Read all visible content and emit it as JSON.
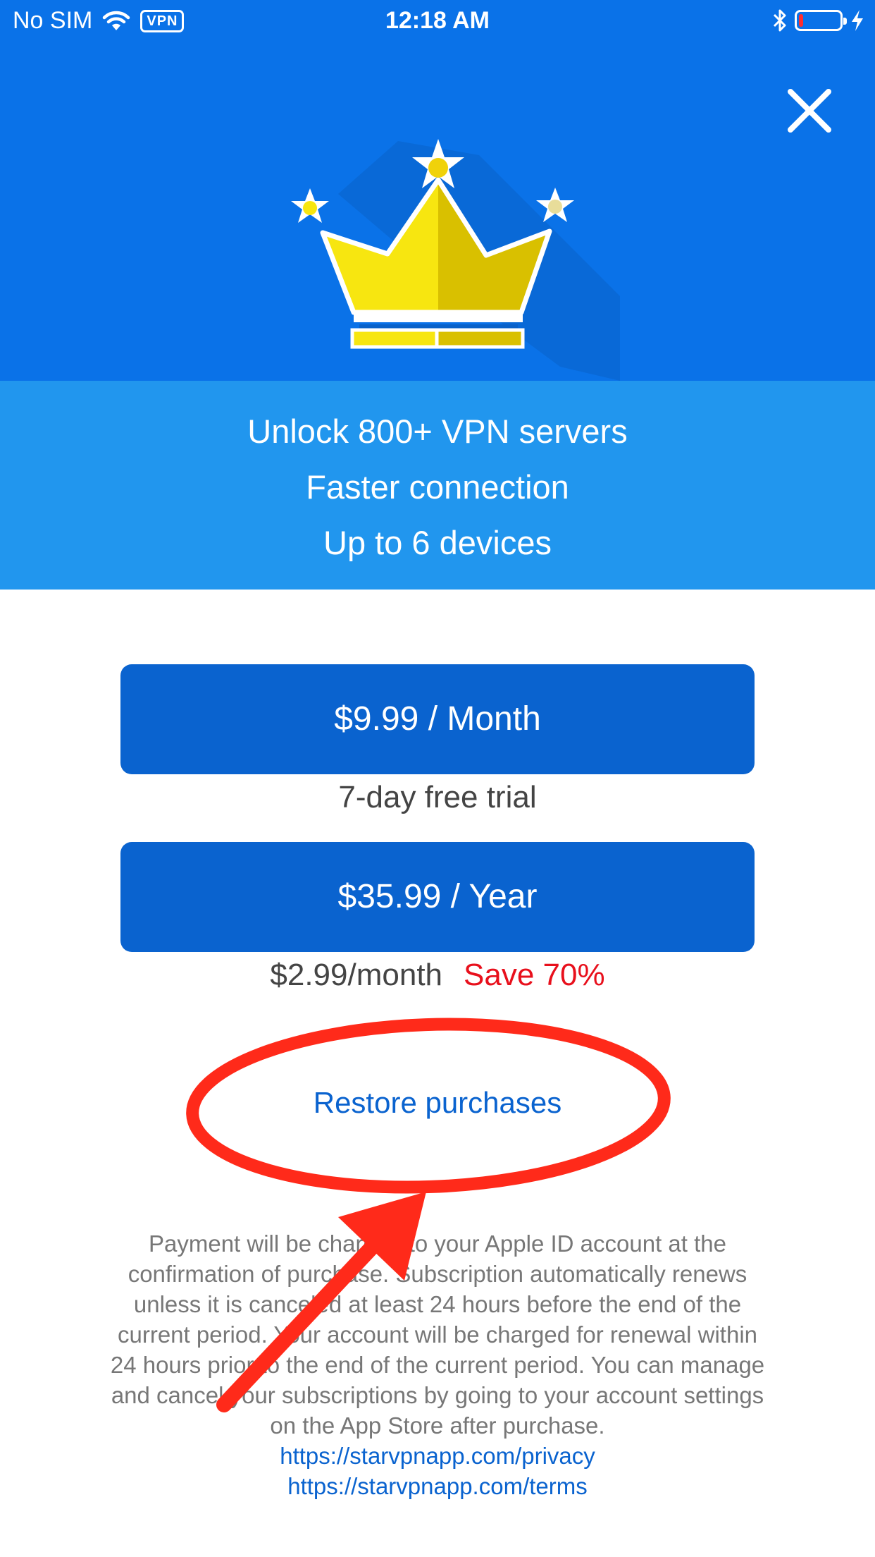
{
  "status_bar": {
    "carrier": "No SIM",
    "vpn_badge": "VPN",
    "time": "12:18 AM",
    "battery_level": 0.1
  },
  "features": [
    "Unlock 800+ VPN servers",
    "Faster connection",
    "Up to 6 devices"
  ],
  "plans": {
    "monthly": {
      "label": "$9.99 / Month",
      "note": "7-day free trial"
    },
    "yearly": {
      "label": "$35.99 / Year",
      "note": "$2.99/month",
      "save": "Save 70%"
    }
  },
  "restore_label": "Restore purchases",
  "legal_text": "Payment will be charged to your Apple ID account at the confirmation of purchase. Subscription automatically renews unless it is canceled at least 24 hours before the end of the current period. Your account will be charged for renewal within 24 hours prior to the end of the current period. You can manage and cancel your subscriptions by going to your account settings on the App Store after purchase.",
  "links": {
    "privacy": "https://starvpnapp.com/privacy",
    "terms": "https://starvpnapp.com/terms"
  },
  "colors": {
    "header_blue": "#0a72e8",
    "features_blue": "#2196ee",
    "button_blue": "#0a63cf",
    "save_red": "#e8101c",
    "annotation_red": "#ff2a1a"
  },
  "icons": [
    "wifi-icon",
    "vpn-badge",
    "bluetooth-icon",
    "battery-icon",
    "charging-icon",
    "close-icon",
    "crown-icon"
  ]
}
